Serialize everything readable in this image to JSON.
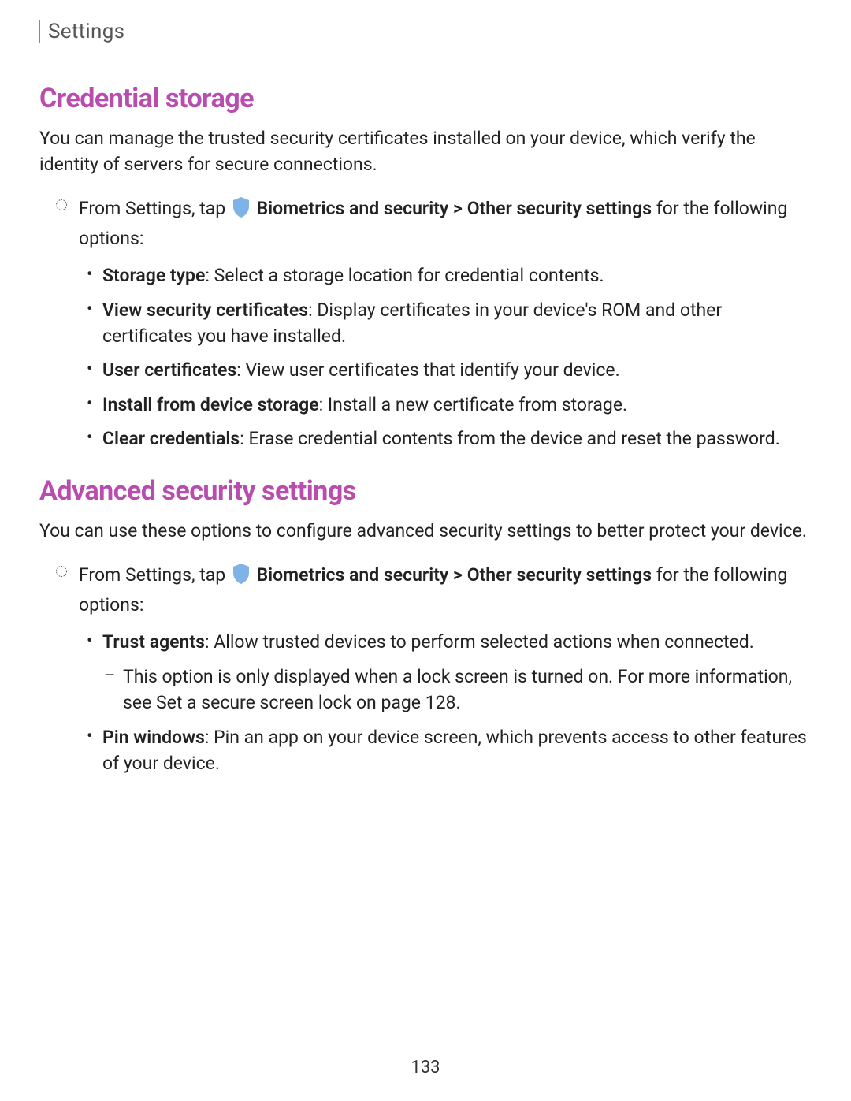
{
  "header": {
    "breadcrumb": "Settings"
  },
  "section1": {
    "heading": "Credential storage",
    "intro": "You can manage the trusted security certificates installed on your device, which verify the identity of servers for secure connections.",
    "instruction": {
      "prefix": "From Settings, tap ",
      "nav_bold1": "Biometrics and security",
      "nav_sep": " > ",
      "nav_bold2": "Other security settings",
      "suffix": " for the following options:"
    },
    "bullets": [
      {
        "term": "Storage type",
        "desc": ": Select a storage location for credential contents."
      },
      {
        "term": "View security certificates",
        "desc": ": Display certificates in your device's ROM and other certificates you have installed."
      },
      {
        "term": "User certificates",
        "desc": ": View user certificates that identify your device."
      },
      {
        "term": "Install from device storage",
        "desc": ": Install a new certificate from storage."
      },
      {
        "term": "Clear credentials",
        "desc": ": Erase credential contents from the device and reset the password."
      }
    ]
  },
  "section2": {
    "heading": "Advanced security settings",
    "intro": "You can use these options to configure advanced security settings to better protect your device.",
    "instruction": {
      "prefix": "From Settings, tap ",
      "nav_bold1": "Biometrics and security",
      "nav_sep": " > ",
      "nav_bold2": "Other security settings",
      "suffix": " for the following options:"
    },
    "bullet1": {
      "term": "Trust agents",
      "desc": ": Allow trusted devices to perform selected actions when connected.",
      "sub_prefix": "This option is only displayed when a lock screen is turned on. For more information, see ",
      "sub_link": "Set a secure screen lock",
      "sub_suffix": " on page 128."
    },
    "bullet2": {
      "term": "Pin windows",
      "desc": ": Pin an app on your device screen, which prevents access to other features of your device."
    }
  },
  "page_number": "133"
}
